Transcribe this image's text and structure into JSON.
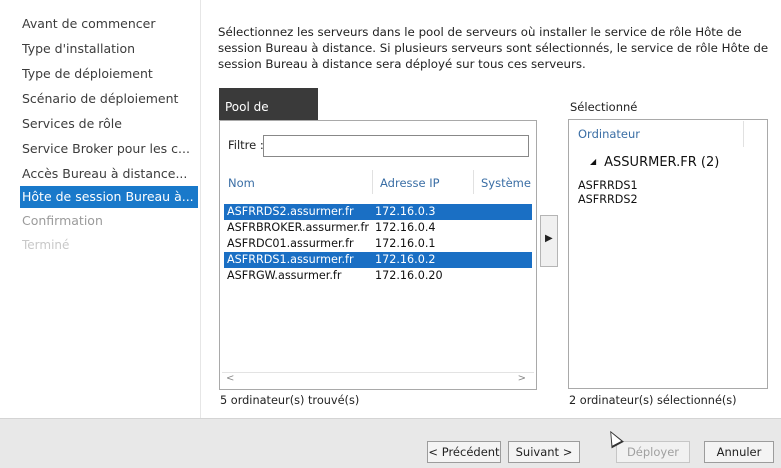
{
  "nav": {
    "items": [
      {
        "label": "Avant de commencer"
      },
      {
        "label": "Type d'installation"
      },
      {
        "label": "Type de déploiement"
      },
      {
        "label": "Scénario de déploiement"
      },
      {
        "label": "Services de rôle"
      },
      {
        "label": "Service Broker pour les c..."
      },
      {
        "label": "Accès Bureau à distance..."
      },
      {
        "label": "Hôte de session Bureau à..."
      },
      {
        "label": "Confirmation"
      },
      {
        "label": "Terminé"
      }
    ]
  },
  "description": "Sélectionnez les serveurs dans le pool de serveurs où installer le service de rôle Hôte de session Bureau à distance. Si plusieurs serveurs sont sélectionnés, le service de rôle Hôte de session Bureau à distance sera déployé sur tous ces serveurs.",
  "pool": {
    "tab_label": "Pool de serveurs",
    "filter_label": "Filtre :",
    "filter_value": "",
    "columns": [
      "Nom",
      "Adresse IP",
      "Système d"
    ],
    "rows": [
      {
        "name": "ASFRRDS2.assurmer.fr",
        "ip": "172.16.0.3",
        "selected": true
      },
      {
        "name": "ASFRBROKER.assurmer.fr",
        "ip": "172.16.0.4",
        "selected": false
      },
      {
        "name": "ASFRDC01.assurmer.fr",
        "ip": "172.16.0.1",
        "selected": false
      },
      {
        "name": "ASFRRDS1.assurmer.fr",
        "ip": "172.16.0.2",
        "selected": true
      },
      {
        "name": "ASFRGW.assurmer.fr",
        "ip": "172.16.0.20",
        "selected": false
      }
    ],
    "scroll_left": "<",
    "scroll_right": ">",
    "count": "5 ordinateur(s) trouvé(s)"
  },
  "selected": {
    "title": "Sélectionné",
    "column": "Ordinateur",
    "group_icon": "triangle-expand-icon",
    "group_label": "ASSURMER.FR (2)",
    "items": [
      "ASFRRDS1",
      "ASFRRDS2"
    ],
    "count": "2 ordinateur(s) sélectionné(s)"
  },
  "move_button_icon": "▶",
  "footer": {
    "prev": "< Précédent",
    "next": "Suivant >",
    "deploy": "Déployer",
    "cancel": "Annuler"
  },
  "colors": {
    "accent": "#1979ca",
    "selection": "#1a6fc4"
  }
}
